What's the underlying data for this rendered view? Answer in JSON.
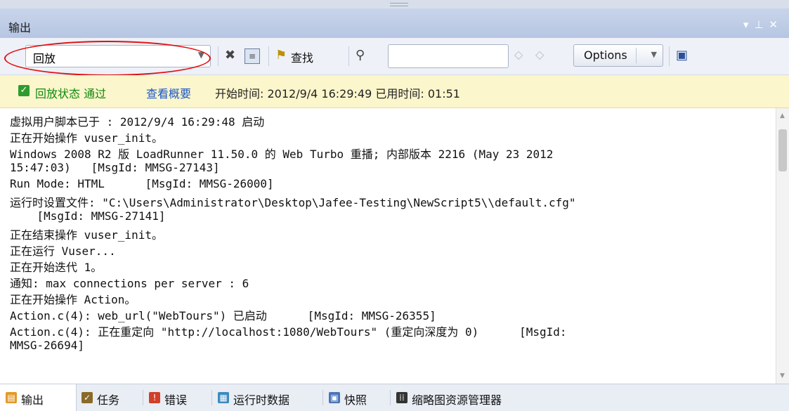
{
  "window": {
    "title": "输出"
  },
  "toolbar": {
    "combo_value": "回放",
    "find_label": "查找",
    "search_placeholder": "",
    "options_label": "Options"
  },
  "status": {
    "replay_status": "回放状态 通过",
    "view_summary": "查看概要",
    "info": "开始时间: 2012/9/4 16:29:49 已用时间: 01:51"
  },
  "output": {
    "lines": [
      "虚拟用户脚本已于 : 2012/9/4 16:29:48 启动",
      "正在开始操作 vuser_init。",
      "Windows 2008 R2 版 LoadRunner 11.50.0 的 Web Turbo 重播; 内部版本 2216 (May 23 2012",
      "15:47:03)   [MsgId: MMSG-27143]",
      "Run Mode: HTML      [MsgId: MMSG-26000]",
      "运行时设置文件: \"C:\\Users\\Administrator\\Desktop\\Jafee-Testing\\NewScript5\\\\default.cfg\"",
      "    [MsgId: MMSG-27141]",
      "正在结束操作 vuser_init。",
      "正在运行 Vuser...",
      "正在开始迭代 1。",
      "通知: max connections per server : 6",
      "正在开始操作 Action。",
      "Action.c(4): web_url(\"WebTours\") 已启动      [MsgId: MMSG-26355]",
      "Action.c(4): 正在重定向 \"http://localhost:1080/WebTours\" (重定向深度为 0)      [MsgId:",
      "MMSG-26694]"
    ]
  },
  "tabs": [
    {
      "label": "输出"
    },
    {
      "label": "任务"
    },
    {
      "label": "错误"
    },
    {
      "label": "运行时数据"
    },
    {
      "label": "快照"
    },
    {
      "label": "缩略图资源管理器"
    }
  ],
  "colors": {
    "accent": "#1d57c9",
    "pass": "#0e8a0e",
    "status_bg": "#fbf6cb",
    "highlight_ring": "#e01010"
  }
}
